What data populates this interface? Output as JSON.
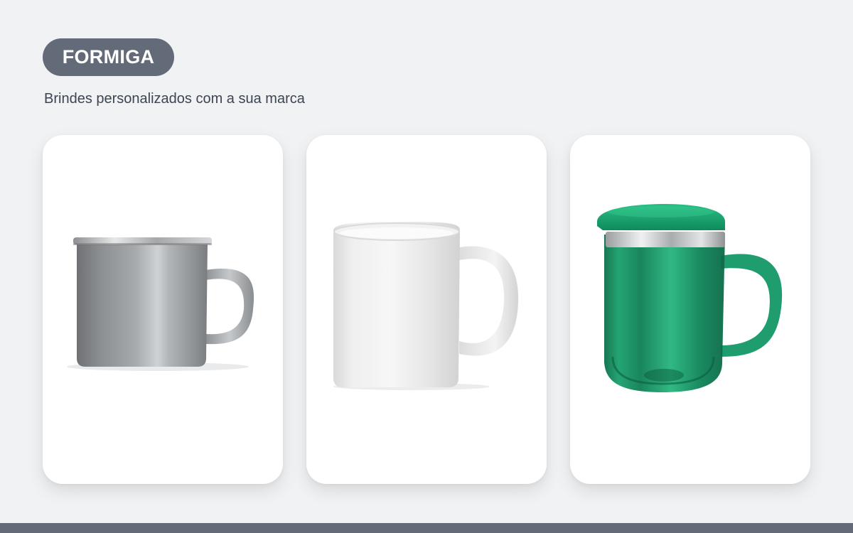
{
  "header": {
    "brand": "FORMIGA",
    "tagline": "Brindes personalizados com a sua marca"
  },
  "products": [
    {
      "image": "enamel-mug-gray-icon"
    },
    {
      "image": "ceramic-mug-white-icon"
    },
    {
      "image": "thermal-mug-green-icon"
    }
  ],
  "colors": {
    "background": "#f0f2f4",
    "brand_pill": "#646b78",
    "tagline_text": "#3d4452",
    "card": "#ffffff",
    "footer_bar": "#646b78",
    "mug_gray": "#8a8d90",
    "mug_white": "#ececec",
    "mug_green": "#0f8a5c"
  }
}
